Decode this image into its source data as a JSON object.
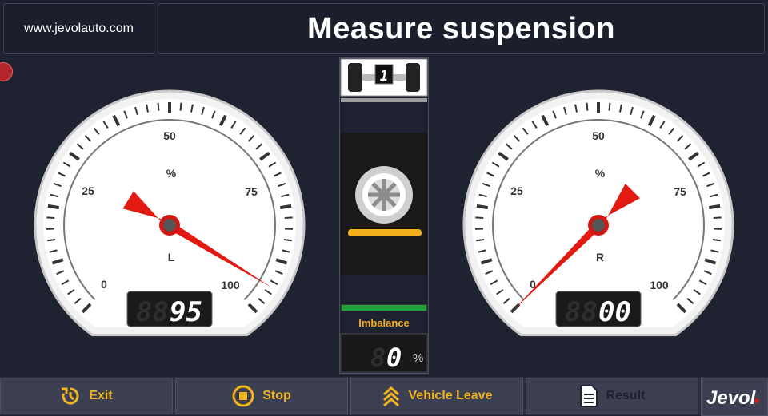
{
  "header": {
    "site": "www.jevolauto.com",
    "title": "Measure suspension"
  },
  "left_gauge": {
    "scale_labels": [
      "0",
      "25",
      "50",
      "75",
      "100"
    ],
    "unit": "%",
    "side": "L",
    "display": "95",
    "needle_value": 95
  },
  "right_gauge": {
    "scale_labels": [
      "0",
      "25",
      "50",
      "75",
      "100"
    ],
    "unit": "%",
    "side": "R",
    "display": "00",
    "needle_value": 0
  },
  "center_panel": {
    "axle_number": "1",
    "imbalance_label": "Imbalance",
    "imbalance_value": "0",
    "imbalance_unit": "%",
    "progress_fraction": 1.0,
    "colors": {
      "accent": "#f3b01b",
      "progress": "#1fa33a"
    }
  },
  "toolbar": {
    "exit_label": "Exit",
    "stop_label": "Stop",
    "leave_label": "Vehicle Leave",
    "result_label": "Result",
    "logo_text": "Jevol"
  },
  "icons": [
    "exit-icon",
    "stop-icon",
    "vehicle-leave-icon",
    "result-icon",
    "wheel-icon",
    "axle-icon"
  ]
}
